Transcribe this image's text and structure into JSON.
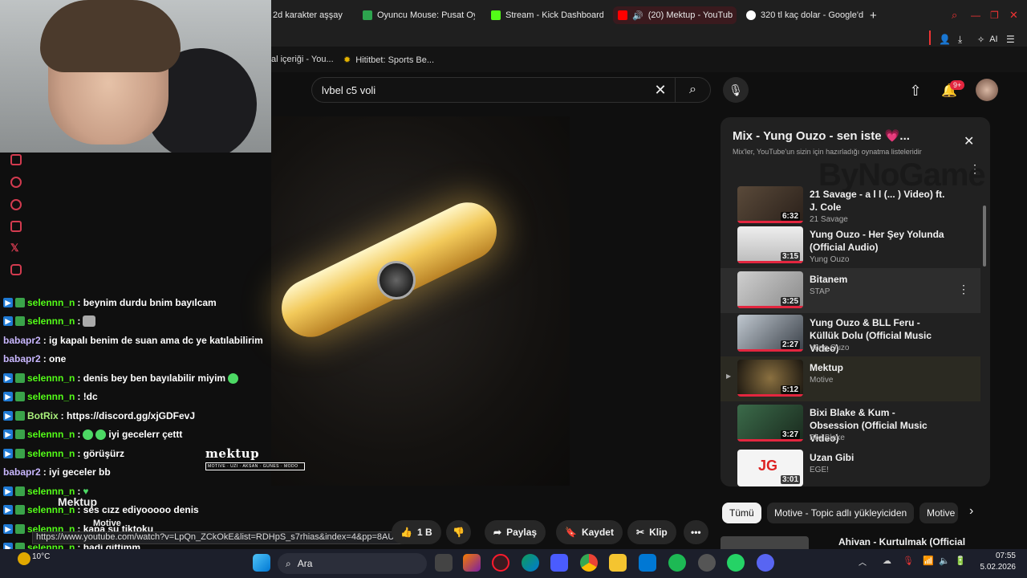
{
  "tabs": [
    {
      "label": "2d karakter aşşay",
      "color": "#888"
    },
    {
      "label": "Oyuncu Mouse: Pusat Oy",
      "color": "#2da44e"
    },
    {
      "label": "Stream - Kick Dashboard",
      "color": "#53fc18"
    },
    {
      "label": "(20) Mektup - YouTub",
      "color": "#ff0000"
    },
    {
      "label": "320 tl kaç dolar - Google'd",
      "color": "#4285f4"
    }
  ],
  "bookmarks": [
    {
      "label": "al içeriği - You..."
    },
    {
      "label": "Hititbet: Sports Be..."
    }
  ],
  "browser": {
    "ai_label": "AI"
  },
  "search": {
    "value": "lvbel c5 voli"
  },
  "header": {
    "notif_count": "9+"
  },
  "video": {
    "logo_title": "mektup",
    "logo_sub": "MOTIVE · UZI · AKSAN · GUNES · MODO"
  },
  "chat": {
    "messages": [
      {
        "user": "selennn_n",
        "text": ": beynim durdu bnim bayılcam"
      },
      {
        "user": "selennn_n",
        "text": ":"
      },
      {
        "user": "babapr2",
        "text": ": ig kapalı benim de suan ama dc ye katılabilirim"
      },
      {
        "user": "babapr2",
        "text": ": one"
      },
      {
        "user": "selennn_n",
        "text": ": denis bey ben bayılabilir miyim"
      },
      {
        "user": "selennn_n",
        "text": ": !dc"
      },
      {
        "user": "BotRix",
        "text": ": https://discord.gg/xjGDFevJ"
      },
      {
        "user": "selennn_n",
        "text": ":"
      },
      {
        "user": "selennn_n",
        "text": ": görüşürz"
      },
      {
        "user": "babapr2",
        "text": ": iyi geceler bb"
      },
      {
        "user": "selennn_n",
        "text": ":"
      },
      {
        "user": "selennn_n",
        "text": ": ses cızz ediyooooo denis"
      },
      {
        "user": "selennn_n",
        "text": ": kapa şu tiktoku"
      },
      {
        "user": "selennn_n",
        "text": ": hadi gittimm"
      },
      {
        "user": "selennn_n",
        "text": ":"
      }
    ],
    "extra_text": "iyi gecelerr çettt",
    "overlay_title": "Mektup",
    "overlay_channel": "Motive"
  },
  "url_tooltip": "https://www.youtube.com/watch?v=LpQn_ZCkOkE&list=RDHpS_s7rhias&index=4&pp=8AUB",
  "playlist": {
    "title": "Mix - Yung Ouzo - sen iste 💗...",
    "subtitle": "Mix'ler, YouTube'un sizin için hazırladığı oynatma listeleridir",
    "items": [
      {
        "title": "21 Savage - a l l (... ) Video) ft. J. Cole",
        "channel": "21 Savage",
        "duration": "6:32"
      },
      {
        "title": "Yung Ouzo - Her Şey Yolunda (Official Audio)",
        "channel": "Yung Ouzo",
        "duration": "3:15"
      },
      {
        "title": "Bitanem",
        "channel": "STAP",
        "duration": "3:25"
      },
      {
        "title": "Yung Ouzo & BLL Feru - Küllük Dolu (Official Music Video)",
        "channel": "Yung Ouzo",
        "duration": "2:27"
      },
      {
        "title": "Mektup",
        "channel": "Motive",
        "duration": "5:12"
      },
      {
        "title": "Bixi Blake & Kum - Obsession (Official Music Video)",
        "channel": "Bixi Blake",
        "duration": "3:27"
      },
      {
        "title": "Uzan Gibi",
        "channel": "EGE!",
        "duration": "3:01"
      }
    ]
  },
  "watermark": "ByNoGame",
  "chips": [
    "Tümü",
    "Motive - Topic adlı yükleyiciden",
    "Motive"
  ],
  "actions": {
    "likes": "1 B",
    "share": "Paylaş",
    "save": "Kaydet",
    "clip": "Klip"
  },
  "next_video": {
    "title": "Ahivan - Kurtulmak (Official"
  },
  "taskbar": {
    "search_placeholder": "Ara",
    "weather": "10°C",
    "time": "07:55",
    "date": "5.02.2026"
  }
}
